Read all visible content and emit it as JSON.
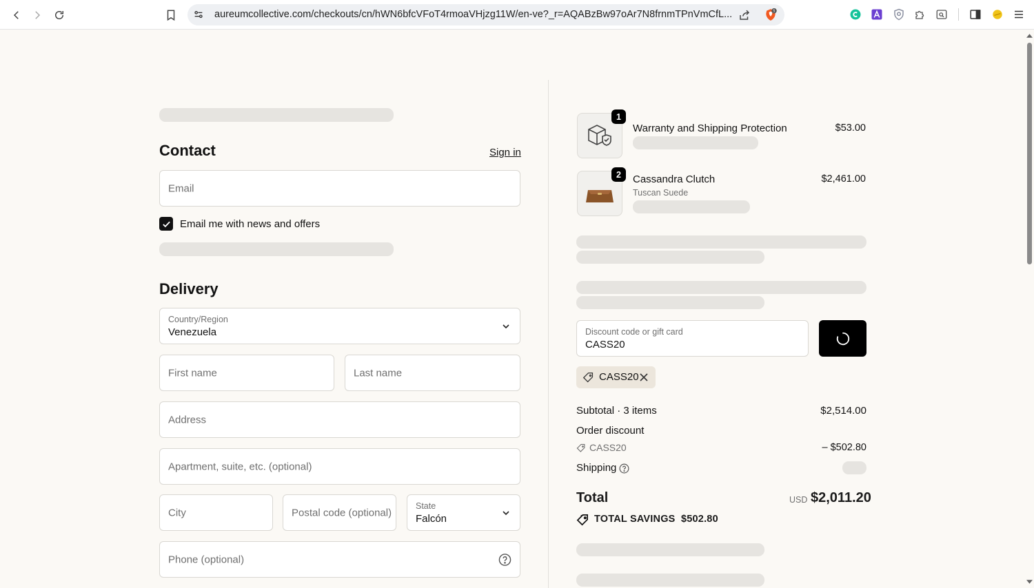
{
  "browser": {
    "url": "aureumcollective.com/checkouts/cn/hWN6bfcVFoT4rmoaVHjzg11W/en-ve?_r=AQABzBw97oAr7N8frnmTPnVmCfL...",
    "brave_badge": "5"
  },
  "contact": {
    "title": "Contact",
    "sign_in": "Sign in",
    "email_placeholder": "Email",
    "newsletter_label": "Email me with news and offers",
    "newsletter_checked": true
  },
  "delivery": {
    "title": "Delivery",
    "country_label": "Country/Region",
    "country_value": "Venezuela",
    "first_name_placeholder": "First name",
    "last_name_placeholder": "Last name",
    "address_placeholder": "Address",
    "apartment_placeholder": "Apartment, suite, etc. (optional)",
    "city_placeholder": "City",
    "postal_placeholder": "Postal code (optional)",
    "state_label": "State",
    "state_value": "Falcón",
    "phone_placeholder": "Phone (optional)"
  },
  "cart": {
    "items": [
      {
        "qty": "1",
        "name": "Warranty and Shipping Protection",
        "variant": "",
        "price": "$53.00",
        "icon": "shipping-protection-icon"
      },
      {
        "qty": "2",
        "name": "Cassandra Clutch",
        "variant": "Tuscan Suede",
        "price": "$2,461.00",
        "icon": "clutch-bag-image"
      }
    ]
  },
  "discount": {
    "label": "Discount code or gift card",
    "value": "CASS20",
    "applied_code": "CASS20"
  },
  "summary": {
    "subtotal_label": "Subtotal · 3 items",
    "subtotal_value": "$2,514.00",
    "order_discount_label": "Order discount",
    "discount_code": "CASS20",
    "discount_value": "– $502.80",
    "shipping_label": "Shipping",
    "total_label": "Total",
    "currency": "USD",
    "total_value": "$2,011.20",
    "savings_label": "TOTAL SAVINGS",
    "savings_value": "$502.80"
  },
  "colors": {
    "page_bg": "#fbf9f5",
    "skeleton": "#e6e4e0",
    "button_black": "#000000",
    "chip_bg": "#ece6dc"
  }
}
